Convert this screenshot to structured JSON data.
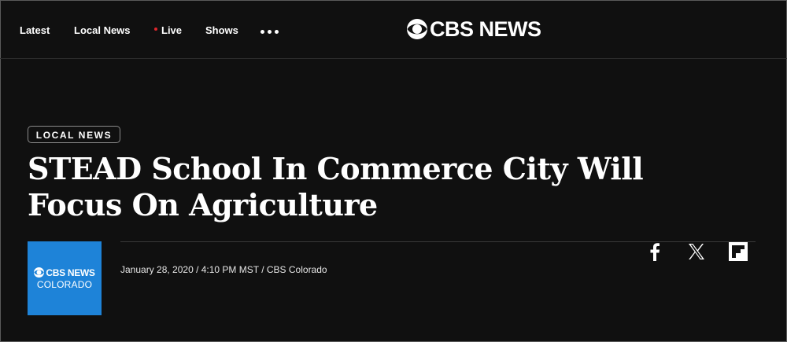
{
  "nav": {
    "items": [
      {
        "label": "Latest"
      },
      {
        "label": "Local News"
      },
      {
        "label": "Live"
      },
      {
        "label": "Shows"
      }
    ],
    "more_icon": "more-dots-icon",
    "logo_text": "CBS NEWS",
    "live_dot_color": "#e0262c"
  },
  "article": {
    "category": "LOCAL NEWS",
    "headline": "STEAD School In Commerce City Will Focus On Agriculture",
    "byline": "January 28, 2020 / 4:10 PM MST / CBS Colorado",
    "station_logo": {
      "line1": "CBS NEWS",
      "line2": "COLORADO",
      "bg_color": "#1e83d8"
    }
  },
  "share": {
    "icons": [
      "facebook-icon",
      "x-icon",
      "flipboard-icon"
    ]
  },
  "colors": {
    "background": "#101010",
    "text": "#ffffff"
  }
}
